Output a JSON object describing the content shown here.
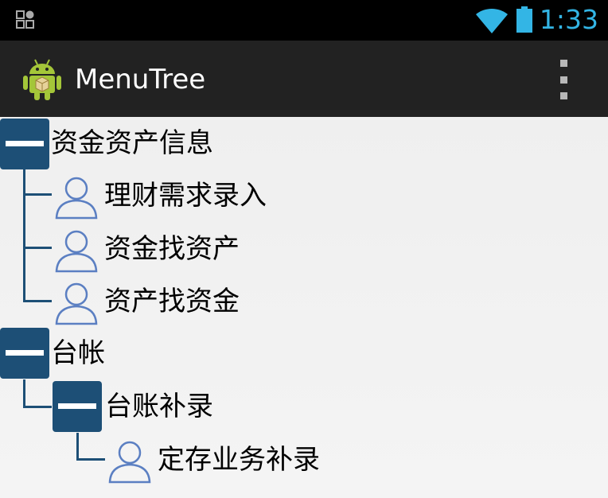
{
  "app": {
    "title": "MenuTree"
  },
  "status_bar": {
    "time": "1:33"
  },
  "colors": {
    "clock": "#33b5e5",
    "tree": "#1d4f76",
    "icon": "#5b7fc2"
  },
  "tree": {
    "root1": {
      "label": "资金资产信息",
      "children": [
        "理财需求录入",
        "资金找资产",
        "资产找资金"
      ]
    },
    "root2": {
      "label": "台帐",
      "child": {
        "label": "台账补录",
        "children": [
          "定存业务补录"
        ]
      }
    }
  }
}
